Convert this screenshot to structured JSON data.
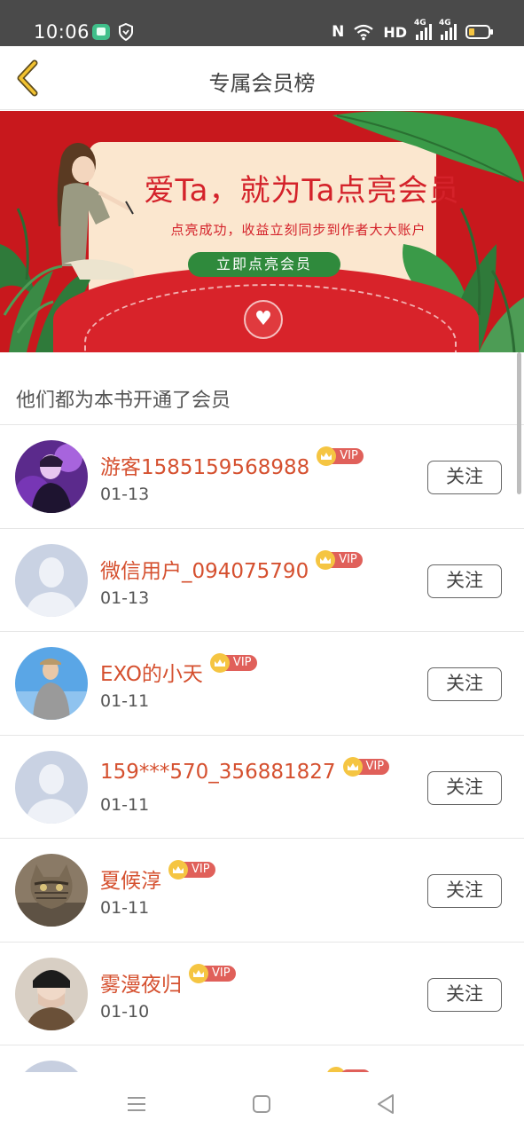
{
  "status_bar": {
    "time": "10:06",
    "nfc": "N",
    "hd": "HD",
    "net1": "4G",
    "net2": "4G"
  },
  "header": {
    "title": "专属会员榜"
  },
  "banner": {
    "headline": "爱Ta，就为Ta点亮会员",
    "subline": "点亮成功，收益立刻同步到作者大大账户",
    "cta_label": "立即点亮会员"
  },
  "section": {
    "label": "他们都为本书开通了会员"
  },
  "badge_text": "VIP",
  "follow_label": "关注",
  "members": [
    {
      "name": "游客1585159568988",
      "date": "01-13",
      "avatar": "purple-photo"
    },
    {
      "name": "微信用户_094075790",
      "date": "01-13",
      "avatar": "default-silhouette"
    },
    {
      "name": "EXO的小天",
      "date": "01-11",
      "avatar": "blue-sky-photo"
    },
    {
      "name": "159***570_356881827",
      "date": "01-11",
      "avatar": "default-silhouette"
    },
    {
      "name": "夏候淳",
      "date": "01-11",
      "avatar": "cat-photo"
    },
    {
      "name": "雾漫夜归",
      "date": "01-10",
      "avatar": "dark-hat-photo"
    }
  ],
  "colors": {
    "name": "#d5502f",
    "banner_red": "#c8181d",
    "cta_green": "#2f8a3c",
    "vip_gold": "#f5c542",
    "vip_red": "#e0605a"
  }
}
